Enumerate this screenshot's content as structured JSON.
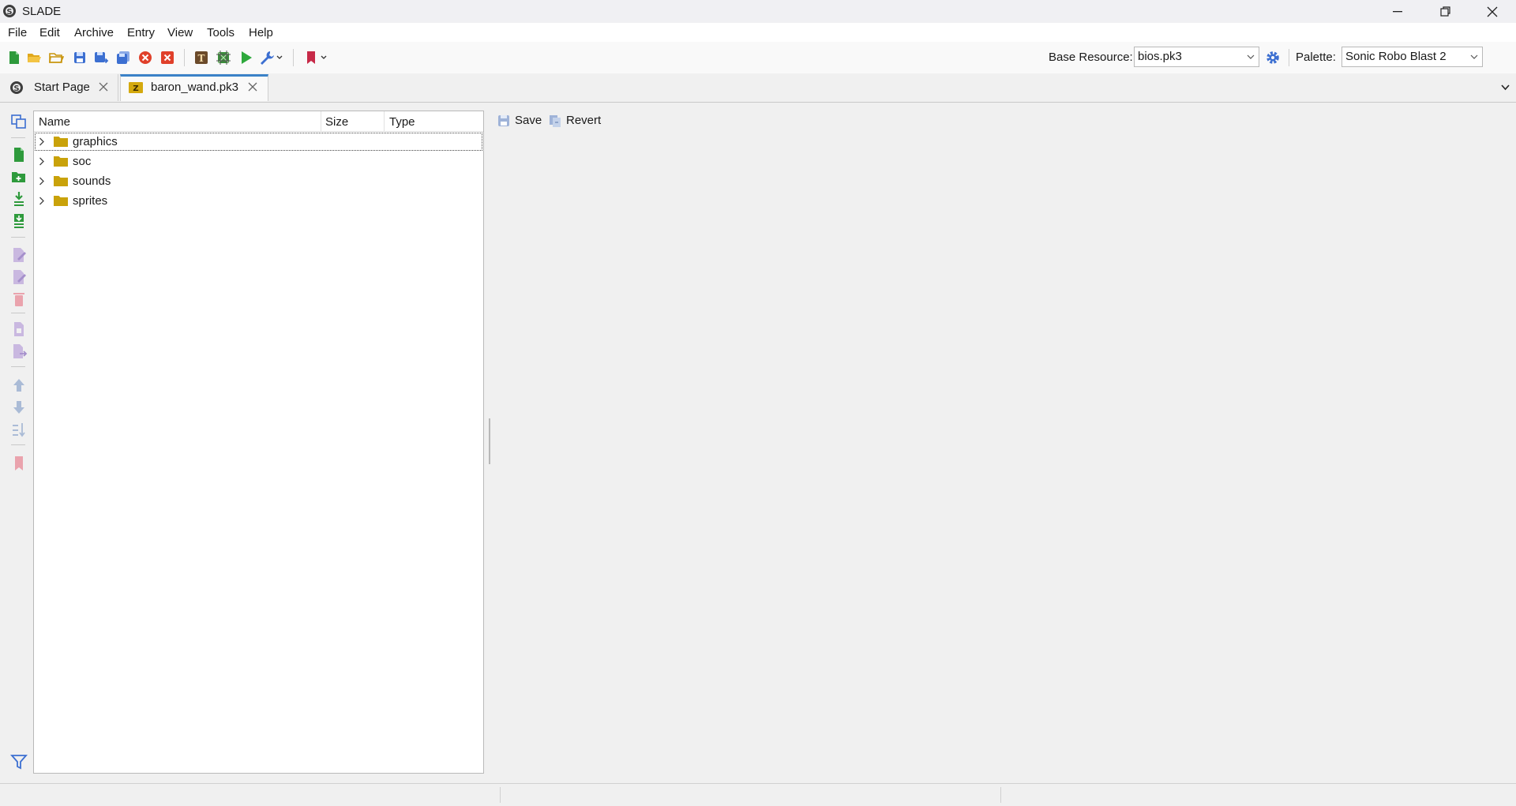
{
  "window": {
    "title": "SLADE"
  },
  "menubar": {
    "items": [
      "File",
      "Edit",
      "Archive",
      "Entry",
      "View",
      "Tools",
      "Help"
    ]
  },
  "toolbar": {
    "base_resource_label": "Base Resource:",
    "base_resource_value": "bios.pk3",
    "palette_label": "Palette:",
    "palette_value": "Sonic Robo Blast 2",
    "icons": [
      "new-archive-icon",
      "open-archive-icon",
      "open-directory-icon",
      "save-icon",
      "save-as-icon",
      "save-all-icon",
      "close-icon",
      "close-all-icon",
      "text-editor-icon",
      "map-editor-icon",
      "run-icon",
      "tools-icon",
      "bookmark-icon",
      "settings-icon"
    ]
  },
  "tabs": [
    {
      "label": "Start Page",
      "active": false
    },
    {
      "label": "baron_wand.pk3",
      "active": true
    }
  ],
  "entry_list": {
    "columns": [
      "Name",
      "Size",
      "Type"
    ],
    "rows": [
      {
        "name": "graphics",
        "size": "",
        "type": ""
      },
      {
        "name": "soc",
        "size": "",
        "type": ""
      },
      {
        "name": "sounds",
        "size": "",
        "type": ""
      },
      {
        "name": "sprites",
        "size": "",
        "type": ""
      }
    ]
  },
  "editor_actions": {
    "save": "Save",
    "revert": "Revert"
  },
  "colors": {
    "accent": "#3b82c8",
    "folder": "#c9a20a",
    "add_green": "#2e9a3c",
    "disabled_purple": "#b9a6d6",
    "disabled_red": "#e79aa6"
  }
}
